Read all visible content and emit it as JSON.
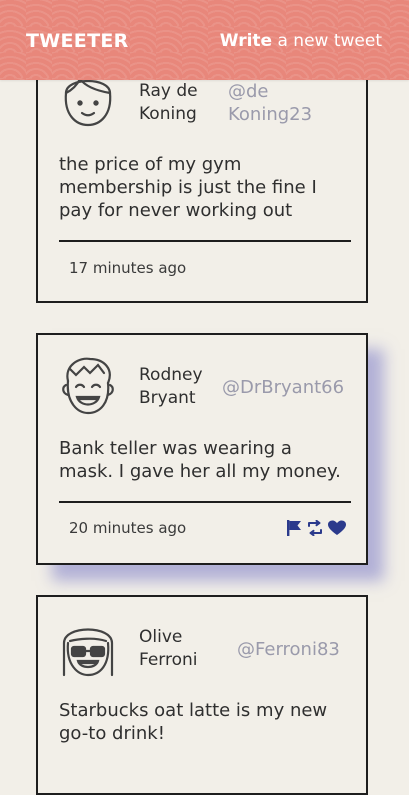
{
  "header": {
    "logo": "TWEETER",
    "compose_bold": "Write",
    "compose_rest": " a new tweet"
  },
  "tweets": [
    {
      "name_line1": "Ray de",
      "name_line2": "Koning",
      "handle_line1": "@de",
      "handle_line2": "Koning23",
      "text": "the price of my gym membership is just the fine I pay for never working out",
      "time": "17 minutes ago"
    },
    {
      "name_line1": "Rodney",
      "name_line2": "Bryant",
      "handle": "@DrBryant66",
      "text": "Bank teller was wearing a mask. I gave her all my money.",
      "time": "20 minutes ago",
      "actions": [
        "flag-icon",
        "retweet-icon",
        "heart-icon"
      ]
    },
    {
      "name_line1": "Olive",
      "name_line2": "Ferroni",
      "handle": "@Ferroni83",
      "text": "Starbucks oat latte is my new go-to drink!"
    }
  ],
  "colors": {
    "header": "#e8877b",
    "background": "#f2efe8",
    "handle": "#9a9aab",
    "action_icon": "#2b3a8c",
    "shadow": "#7d7dc8"
  }
}
